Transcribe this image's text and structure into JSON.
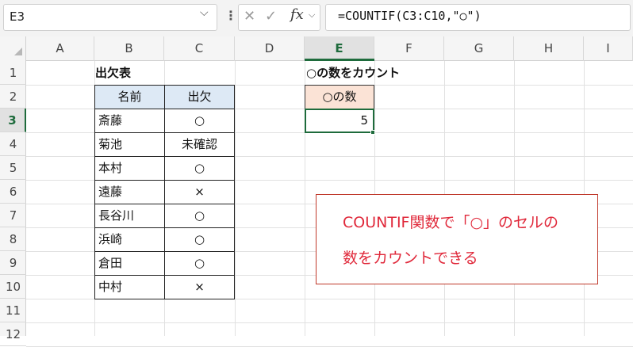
{
  "formula_bar": {
    "name_box": "E3",
    "formula": "=COUNTIF(C3:C10,\"○\")",
    "cancel_glyph": "✕",
    "enter_glyph": "✓",
    "fx_label": "fx"
  },
  "columns": [
    "A",
    "B",
    "C",
    "D",
    "E",
    "F",
    "G",
    "H",
    "I"
  ],
  "rows": [
    "1",
    "2",
    "3",
    "4",
    "5",
    "6",
    "7",
    "8",
    "9",
    "10",
    "11",
    "12"
  ],
  "selected_cell": "E3",
  "sheet": {
    "table_title": "出欠表",
    "headers": [
      "名前",
      "出欠"
    ],
    "records": [
      {
        "name": "斎藤",
        "status": "○"
      },
      {
        "name": "菊池",
        "status": "未確認"
      },
      {
        "name": "本村",
        "status": "○"
      },
      {
        "name": "遠藤",
        "status": "×"
      },
      {
        "name": "長谷川",
        "status": "○"
      },
      {
        "name": "浜崎",
        "status": "○"
      },
      {
        "name": "倉田",
        "status": "○"
      },
      {
        "name": "中村",
        "status": "×"
      }
    ],
    "count_title": "○の数をカウント",
    "count_header": "○の数",
    "count_value": "5"
  },
  "callout": {
    "line1": "COUNTIF関数で「○」のセルの",
    "line2": "数をカウントできる"
  },
  "colors": {
    "accent": "#1e6b3c",
    "header_fill": "#dde9f5",
    "count_fill": "#fbe3d6",
    "callout_text": "#e0283a",
    "callout_border": "#c0392b"
  }
}
